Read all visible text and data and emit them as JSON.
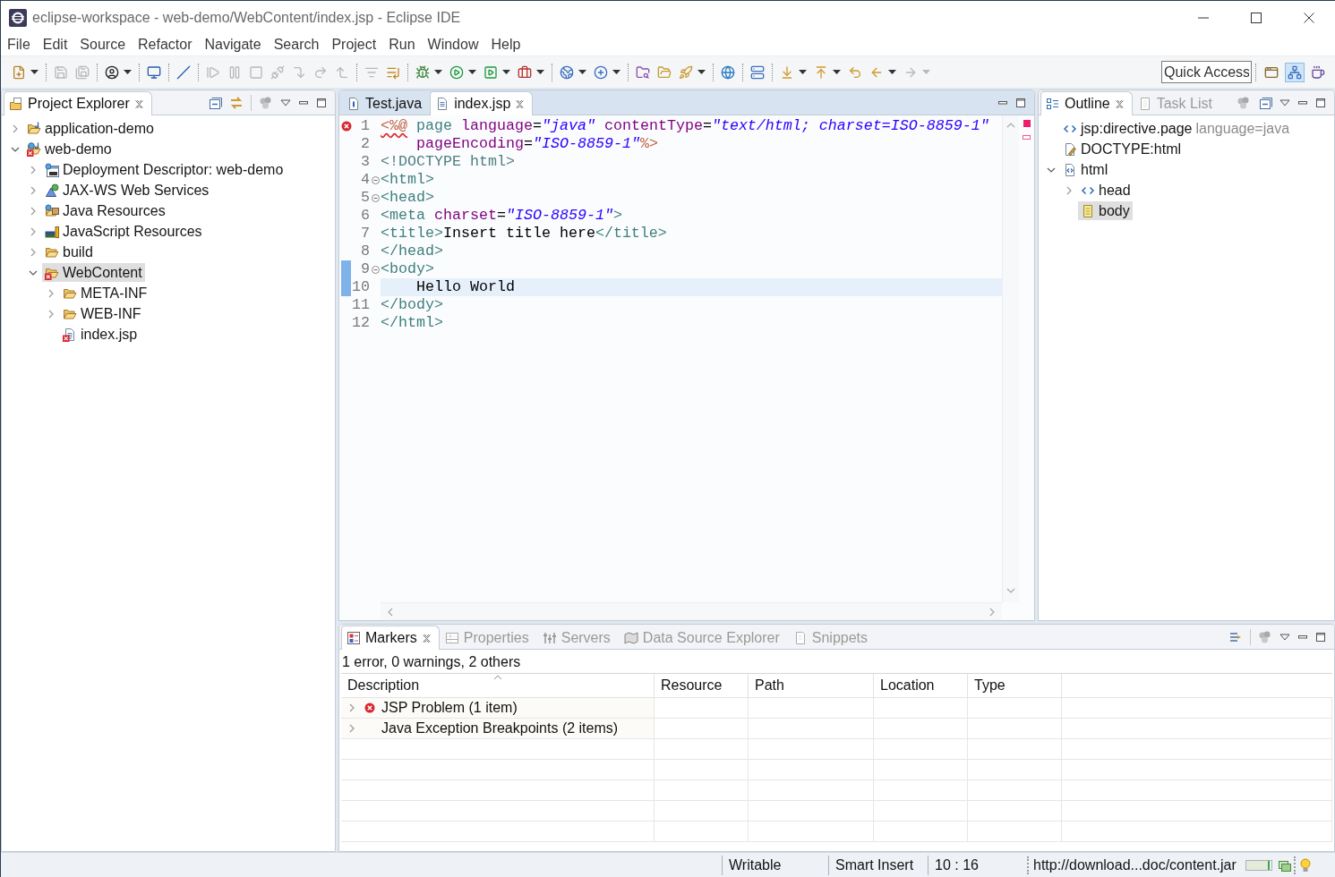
{
  "window": {
    "title": "eclipse-workspace - web-demo/WebContent/index.jsp - Eclipse IDE"
  },
  "menu": [
    "File",
    "Edit",
    "Source",
    "Refactor",
    "Navigate",
    "Search",
    "Project",
    "Run",
    "Window",
    "Help"
  ],
  "toolbar": [
    {
      "kind": "new",
      "disabled": false,
      "dropdown": true
    },
    {
      "kind": "separator"
    },
    {
      "kind": "save",
      "disabled": true,
      "dropdown": false
    },
    {
      "kind": "save-all",
      "disabled": true,
      "dropdown": false
    },
    {
      "kind": "separator"
    },
    {
      "kind": "profile",
      "disabled": false,
      "dropdown": true
    },
    {
      "kind": "separator"
    },
    {
      "kind": "console",
      "disabled": false,
      "dropdown": false
    },
    {
      "kind": "separator"
    },
    {
      "kind": "skip-breakpoints",
      "disabled": false,
      "dropdown": false
    },
    {
      "kind": "separator"
    },
    {
      "kind": "resume",
      "disabled": true,
      "dropdown": false
    },
    {
      "kind": "suspend",
      "disabled": true,
      "dropdown": false
    },
    {
      "kind": "terminate",
      "disabled": true,
      "dropdown": false
    },
    {
      "kind": "disconnect",
      "disabled": true,
      "dropdown": false
    },
    {
      "kind": "step-into",
      "disabled": true,
      "dropdown": false
    },
    {
      "kind": "step-over",
      "disabled": true,
      "dropdown": false
    },
    {
      "kind": "step-return",
      "disabled": true,
      "dropdown": false
    },
    {
      "kind": "separator"
    },
    {
      "kind": "step-filters",
      "disabled": true,
      "dropdown": false
    },
    {
      "kind": "drop-to-frame",
      "disabled": false,
      "dropdown": false
    },
    {
      "kind": "separator"
    },
    {
      "kind": "debug",
      "disabled": false,
      "dropdown": true
    },
    {
      "kind": "run",
      "disabled": false,
      "dropdown": true
    },
    {
      "kind": "coverage",
      "disabled": false,
      "dropdown": true
    },
    {
      "kind": "external-tools",
      "disabled": false,
      "dropdown": true
    },
    {
      "kind": "separator"
    },
    {
      "kind": "new-web-project",
      "disabled": false,
      "dropdown": true
    },
    {
      "kind": "new-class",
      "disabled": false,
      "dropdown": true
    },
    {
      "kind": "separator"
    },
    {
      "kind": "open-type",
      "disabled": false,
      "dropdown": false
    },
    {
      "kind": "open-folder",
      "disabled": false,
      "dropdown": false
    },
    {
      "kind": "rocket",
      "disabled": false,
      "dropdown": true
    },
    {
      "kind": "separator"
    },
    {
      "kind": "globe",
      "disabled": false,
      "dropdown": false
    },
    {
      "kind": "separator"
    },
    {
      "kind": "server",
      "disabled": false,
      "dropdown": false
    },
    {
      "kind": "separator"
    },
    {
      "kind": "next-annotation",
      "disabled": false,
      "dropdown": true
    },
    {
      "kind": "previous-annotation",
      "disabled": false,
      "dropdown": true
    },
    {
      "kind": "last-edit",
      "disabled": false,
      "dropdown": false
    },
    {
      "kind": "back",
      "disabled": false,
      "dropdown": true
    },
    {
      "kind": "forward",
      "disabled": true,
      "dropdown": true
    }
  ],
  "quick_access": {
    "placeholder": "Quick Access"
  },
  "perspective_bar": [
    {
      "kind": "open-perspective",
      "selected": false
    },
    {
      "kind": "javaee",
      "selected": true
    },
    {
      "kind": "java",
      "selected": false
    }
  ],
  "explorer": {
    "tabs": [
      {
        "label": "Project Explorer",
        "kind": "explorer",
        "selected": true
      }
    ],
    "items": [
      {
        "label": "application-demo",
        "kind": "project",
        "expanded": false,
        "error": false,
        "selected": false
      },
      {
        "label": "web-demo",
        "kind": "web-project",
        "expanded": true,
        "error": true,
        "selected": false,
        "children": [
          {
            "label": "Deployment Descriptor: web-demo",
            "kind": "descriptor",
            "expanded": false,
            "error": false,
            "selected": false
          },
          {
            "label": "JAX-WS Web Services",
            "kind": "webservices",
            "expanded": false,
            "error": false,
            "selected": false
          },
          {
            "label": "Java Resources",
            "kind": "java-resources",
            "expanded": false,
            "error": false,
            "selected": false
          },
          {
            "label": "JavaScript Resources",
            "kind": "js-resources",
            "expanded": false,
            "error": false,
            "selected": false
          },
          {
            "label": "build",
            "kind": "folder",
            "expanded": false,
            "error": false,
            "selected": false
          },
          {
            "label": "WebContent",
            "kind": "folder",
            "expanded": true,
            "error": true,
            "selected": true,
            "children": [
              {
                "label": "META-INF",
                "kind": "folder",
                "expanded": false,
                "error": false,
                "selected": false
              },
              {
                "label": "WEB-INF",
                "kind": "folder",
                "expanded": false,
                "error": false,
                "selected": false
              },
              {
                "label": "index.jsp",
                "kind": "jsp-file",
                "error": true,
                "selected": false
              }
            ]
          }
        ]
      }
    ]
  },
  "editor": {
    "tabs": [
      {
        "label": "Test.java",
        "kind": "java",
        "selected": false
      },
      {
        "label": "index.jsp",
        "kind": "jsp",
        "selected": true
      }
    ],
    "lines": [
      {
        "number": "1",
        "error": true,
        "changed": false,
        "foldable": false,
        "current": false,
        "tokens": [
          {
            "kind": "delim-error",
            "text": "<%@"
          },
          {
            "kind": "keyword",
            "text": " page"
          },
          {
            "kind": "attr",
            "text": " language"
          },
          {
            "kind": "eq",
            "text": "="
          },
          {
            "kind": "value",
            "text": "\"java\""
          },
          {
            "kind": "attr",
            "text": " contentType"
          },
          {
            "kind": "eq",
            "text": "="
          },
          {
            "kind": "value",
            "text": "\"text/html; charset=ISO-8859-1\""
          }
        ]
      },
      {
        "number": "2",
        "error": false,
        "changed": false,
        "foldable": false,
        "current": false,
        "tokens": [
          {
            "kind": "attr",
            "text": "    pageEncoding"
          },
          {
            "kind": "eq",
            "text": "="
          },
          {
            "kind": "value",
            "text": "\"ISO-8859-1\""
          },
          {
            "kind": "delim",
            "text": "%>"
          }
        ]
      },
      {
        "number": "3",
        "error": false,
        "changed": false,
        "foldable": false,
        "current": false,
        "tokens": [
          {
            "kind": "doctype",
            "text": "<!DOCTYPE html>"
          }
        ]
      },
      {
        "number": "4",
        "error": false,
        "changed": false,
        "foldable": true,
        "current": false,
        "tokens": [
          {
            "kind": "tag",
            "text": "<html>"
          }
        ]
      },
      {
        "number": "5",
        "error": false,
        "changed": false,
        "foldable": true,
        "current": false,
        "tokens": [
          {
            "kind": "tag",
            "text": "<head>"
          }
        ]
      },
      {
        "number": "6",
        "error": false,
        "changed": false,
        "foldable": false,
        "current": false,
        "tokens": [
          {
            "kind": "tag",
            "text": "<meta"
          },
          {
            "kind": "attr",
            "text": " charset"
          },
          {
            "kind": "eq",
            "text": "="
          },
          {
            "kind": "value",
            "text": "\"ISO-8859-1\""
          },
          {
            "kind": "tag",
            "text": ">"
          }
        ]
      },
      {
        "number": "7",
        "error": false,
        "changed": false,
        "foldable": false,
        "current": false,
        "tokens": [
          {
            "kind": "tag",
            "text": "<title>"
          },
          {
            "kind": "text",
            "text": "Insert title here"
          },
          {
            "kind": "tag",
            "text": "</title>"
          }
        ]
      },
      {
        "number": "8",
        "error": false,
        "changed": false,
        "foldable": false,
        "current": false,
        "tokens": [
          {
            "kind": "tag",
            "text": "</head>"
          }
        ]
      },
      {
        "number": "9",
        "error": false,
        "changed": true,
        "foldable": true,
        "current": false,
        "tokens": [
          {
            "kind": "tag",
            "text": "<body>"
          }
        ]
      },
      {
        "number": "10",
        "error": false,
        "changed": true,
        "foldable": false,
        "current": true,
        "tokens": [
          {
            "kind": "text",
            "text": "    Hello World"
          }
        ]
      },
      {
        "number": "11",
        "error": false,
        "changed": false,
        "foldable": false,
        "current": false,
        "tokens": [
          {
            "kind": "tag",
            "text": "</body>"
          }
        ]
      },
      {
        "number": "12",
        "error": false,
        "changed": false,
        "foldable": false,
        "current": false,
        "tokens": [
          {
            "kind": "tag",
            "text": "</html>"
          }
        ]
      }
    ]
  },
  "outline": {
    "tabs": [
      {
        "label": "Outline",
        "kind": "outline",
        "selected": true
      },
      {
        "label": "Task List",
        "kind": "tasks",
        "selected": false
      }
    ],
    "items": [
      {
        "label": "jsp:directive.page",
        "detail": "language=java",
        "kind": "tag",
        "selected": false
      },
      {
        "label": "DOCTYPE:html",
        "kind": "doctype",
        "selected": false
      },
      {
        "label": "html",
        "kind": "element",
        "expanded": true,
        "selected": false,
        "children": [
          {
            "label": "head",
            "kind": "tag",
            "expanded": false,
            "selected": false
          },
          {
            "label": "body",
            "kind": "body",
            "selected": true
          }
        ]
      }
    ]
  },
  "markers": {
    "tabs": [
      {
        "label": "Markers",
        "kind": "markers",
        "selected": true
      },
      {
        "label": "Properties",
        "kind": "properties",
        "selected": false
      },
      {
        "label": "Servers",
        "kind": "servers",
        "selected": false
      },
      {
        "label": "Data Source Explorer",
        "kind": "data-source",
        "selected": false
      },
      {
        "label": "Snippets",
        "kind": "snippets",
        "selected": false
      }
    ],
    "summary": "1 error, 0 warnings, 2 others",
    "columns": [
      {
        "label": "Description",
        "sorted": true
      },
      {
        "label": "Resource",
        "sorted": false
      },
      {
        "label": "Path",
        "sorted": false
      },
      {
        "label": "Location",
        "sorted": false
      },
      {
        "label": "Type",
        "sorted": false
      }
    ],
    "rows": [
      {
        "description": "JSP Problem (1 item)",
        "error": true,
        "expanded": false
      },
      {
        "description": "Java Exception Breakpoints (2 items)",
        "error": false,
        "expanded": false
      }
    ]
  },
  "status_bar": {
    "fields": [
      "Writable",
      "Smart Insert",
      "10 : 16"
    ],
    "job": "http://download...doc/content.jar",
    "progress": {
      "level": 0.95
    }
  }
}
